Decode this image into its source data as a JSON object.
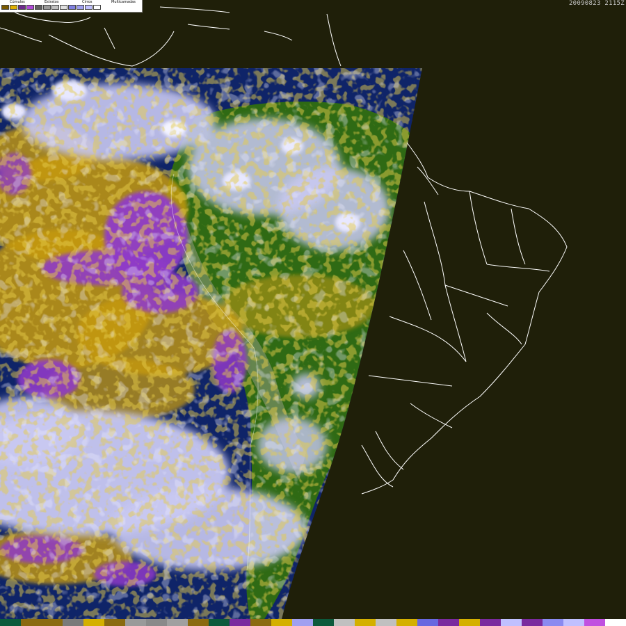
{
  "timestamp": "20090823 2115Z",
  "legend": {
    "labels": [
      "Cúmulos",
      "Estratos",
      "Cirros",
      "Multicamadas"
    ],
    "swatches": [
      "#7a5a00",
      "#e0b000",
      "#6e2a8e",
      "#b048d8",
      "#606060",
      "#9a9a9a",
      "#c0c0c0",
      "#e0e0e0",
      "#8080e0",
      "#a0a0f0",
      "#c0c0ff",
      "#ffffff"
    ]
  },
  "colors": {
    "space": "#1f1f09",
    "ocean": "#0f2468",
    "land": "#2f6a14",
    "andes": "#6f8a58",
    "cumulus_low": "#c69a12",
    "stratus": "#8f3bc8",
    "cirrus": "#c9c9f2",
    "thick_cloud": "#e8e8ff",
    "coastline": "#ffffff"
  },
  "colorbar": [
    "#0c5a3c",
    "#8a6a10",
    "#8a6a10",
    "#7a7a7a",
    "#d4b000",
    "#8a6a10",
    "#9a9a9a",
    "#8a8a8a",
    "#a0a0a0",
    "#8a6a10",
    "#0c5a3c",
    "#7a2a9e",
    "#8a6a10",
    "#d4b000",
    "#a0a0f0",
    "#0c5a3c",
    "#c0c0c0",
    "#d4b000",
    "#c0c0c0",
    "#d4b000",
    "#6868e0",
    "#7a2a9e",
    "#d4b000",
    "#7a2a9e",
    "#c0c0ff",
    "#7a2a9e",
    "#8a8af0",
    "#c0c0ff",
    "#c050e0",
    "#ffffff"
  ]
}
